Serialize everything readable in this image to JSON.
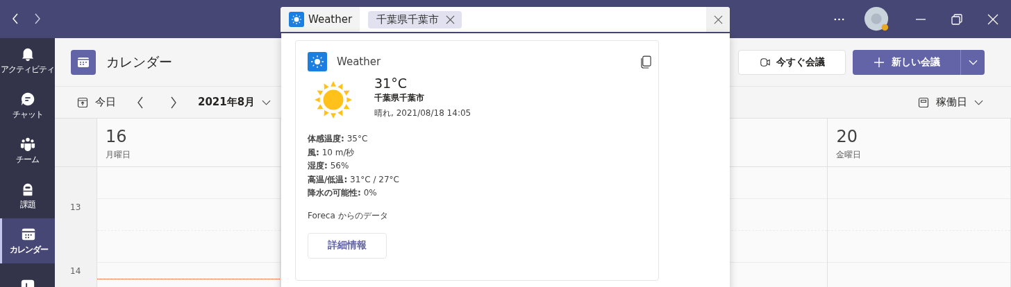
{
  "search": {
    "app": "Weather",
    "tag": "千葉県千葉市"
  },
  "rail": [
    {
      "label": "アクティビティ",
      "selected": false
    },
    {
      "label": "チャット",
      "selected": false
    },
    {
      "label": "チーム",
      "selected": false
    },
    {
      "label": "課題",
      "selected": false
    },
    {
      "label": "カレンダー",
      "selected": true
    },
    {
      "selected": false
    }
  ],
  "header": {
    "title": "カレンダー",
    "meet_now": "今すぐ会議",
    "new_meeting": "新しい会議"
  },
  "toolbar": {
    "today": "今日",
    "month": "2021年8月",
    "view": "稼働日"
  },
  "days": [
    {
      "date": "16",
      "weekday": "月曜日"
    },
    {
      "date": "20",
      "weekday": "金曜日"
    }
  ],
  "hours": [
    "13",
    "14"
  ],
  "weather": {
    "app": "Weather",
    "temperature": "31°C",
    "location": "千葉県千葉市",
    "condition": "晴れ, 2021/08/18 14:05",
    "details": [
      "**体感温度:** 35°C",
      "**風:** 10 m/秒",
      "**湿度:** 56%",
      "**高温/低温:** 31°C / 27°C",
      "**降水の可能性:** 0%"
    ],
    "source": "Foreca からのデータ",
    "button": "詳細情報"
  }
}
